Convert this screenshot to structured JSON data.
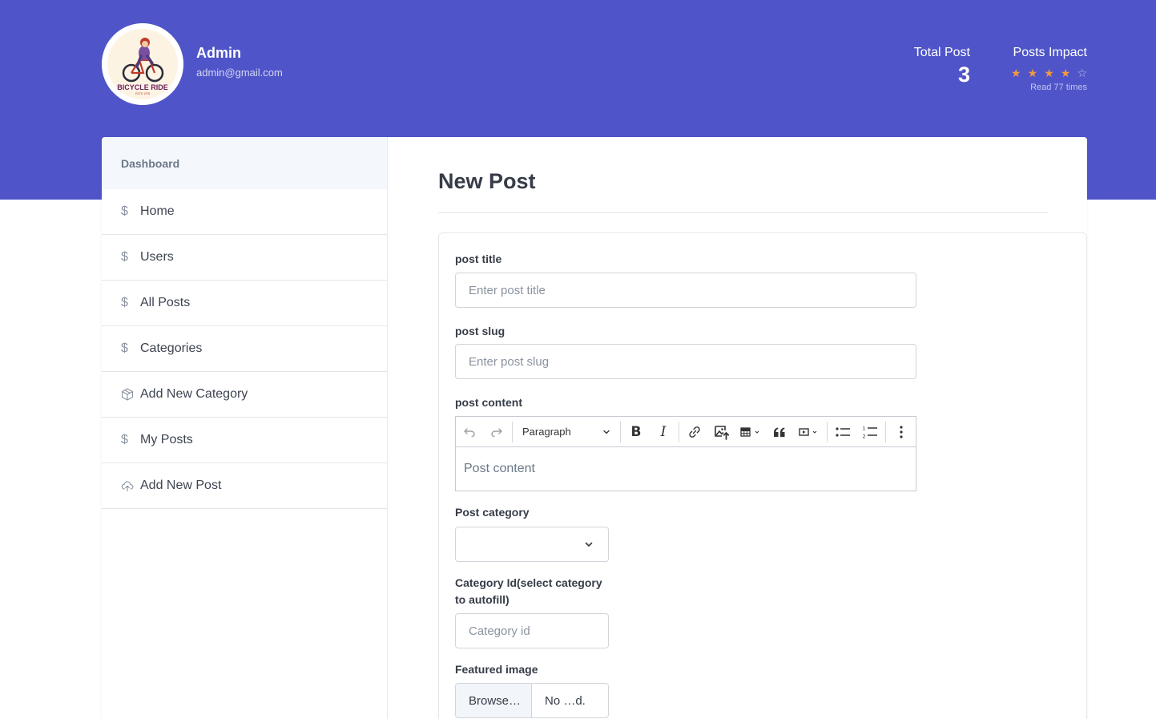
{
  "profile": {
    "name": "Admin",
    "email": "admin@gmail.com",
    "logo_text": "BICYCLE RIDE",
    "logo_subtext": "ESTD 1978"
  },
  "stats": {
    "total_post_label": "Total Post",
    "total_post_value": "3",
    "impact_label": "Posts Impact",
    "rating": 4,
    "rating_max": 5,
    "read_times": "Read 77 times"
  },
  "colors": {
    "header_bg": "#4f55c8",
    "star_filled": "#f19a3e",
    "star_empty": "#c3c6ee"
  },
  "sidebar": {
    "heading": "Dashboard",
    "items": [
      {
        "label": "Home",
        "icon": "dollar-icon"
      },
      {
        "label": "Users",
        "icon": "dollar-icon"
      },
      {
        "label": "All Posts",
        "icon": "dollar-icon"
      },
      {
        "label": "Categories",
        "icon": "dollar-icon"
      },
      {
        "label": "Add New Category",
        "icon": "box-icon"
      },
      {
        "label": "My Posts",
        "icon": "dollar-icon"
      },
      {
        "label": "Add New Post",
        "icon": "cloud-upload-icon"
      }
    ]
  },
  "main": {
    "title": "New Post",
    "form": {
      "post_title_label": "post title",
      "post_title_placeholder": "Enter post title",
      "post_slug_label": "post slug",
      "post_slug_placeholder": "Enter post slug",
      "post_content_label": "post content",
      "editor_paragraph": "Paragraph",
      "editor_placeholder": "Post content",
      "category_label": "Post category",
      "category_selected": "",
      "category_id_label": "Category Id(select category to autofill)",
      "category_id_placeholder": "Category id",
      "featured_image_label": "Featured image",
      "browse_label": "Browse…",
      "file_status": "No …d."
    }
  }
}
